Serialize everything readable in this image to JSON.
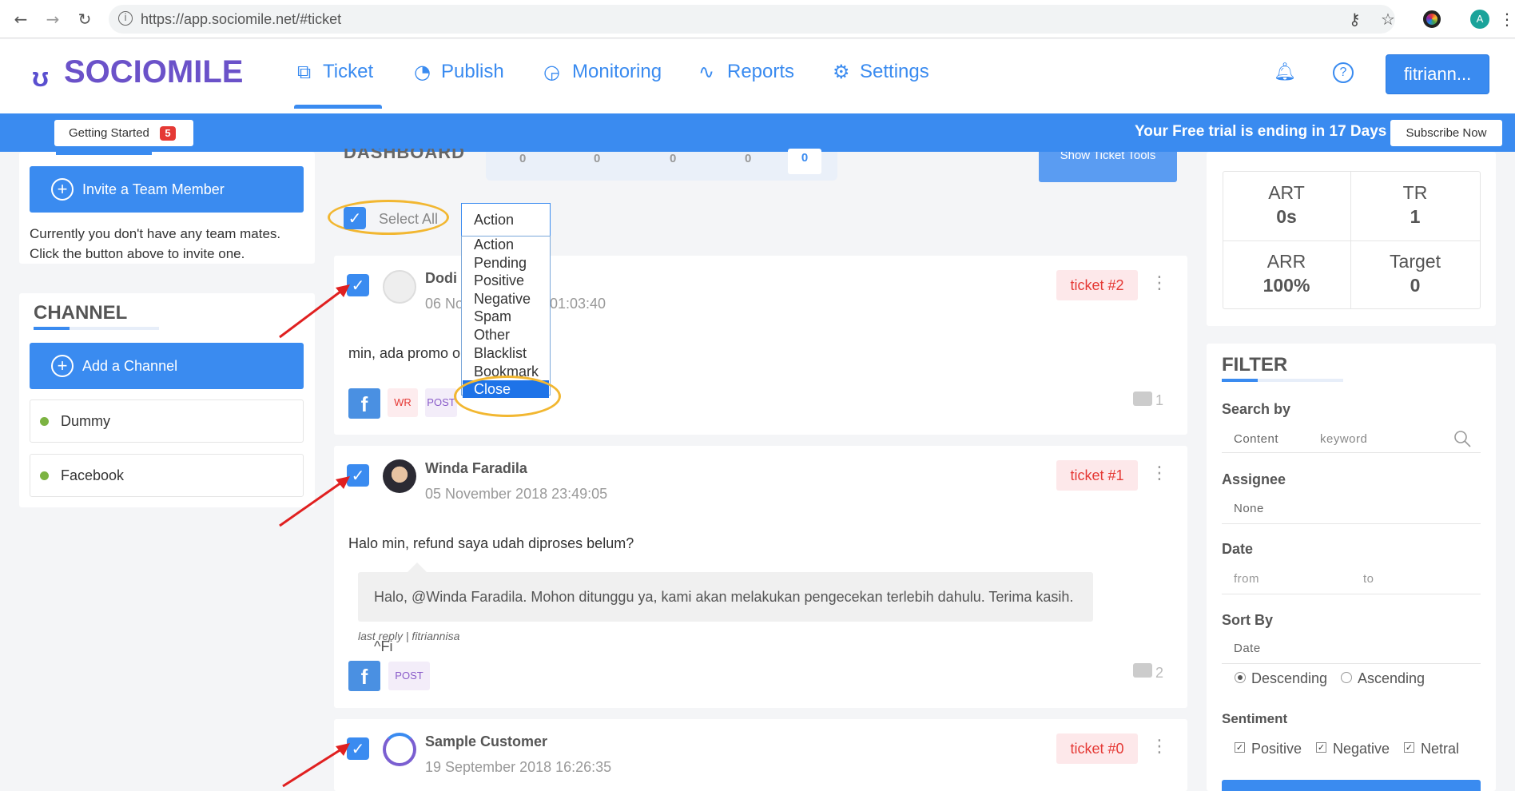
{
  "browser": {
    "url": "https://app.sociomile.net/#ticket",
    "profile_initial": "A"
  },
  "header": {
    "logo": "SOCIOMILE",
    "nav": [
      {
        "label": "Ticket",
        "icon": "ticket-icon",
        "active": true
      },
      {
        "label": "Publish",
        "icon": "clock-icon"
      },
      {
        "label": "Monitoring",
        "icon": "monitor-icon"
      },
      {
        "label": "Reports",
        "icon": "pulse-icon"
      },
      {
        "label": "Settings",
        "icon": "gear-icon"
      }
    ],
    "user": "fitriann..."
  },
  "trial_bar": {
    "getting_started": "Getting Started",
    "badge": "5",
    "message": "Your Free trial is ending in 17 Days",
    "subscribe": "Subscribe Now"
  },
  "team": {
    "invite_label": "Invite a Team Member",
    "note": "Currently you don't have any team mates. Click the button above to invite one."
  },
  "channel": {
    "title": "CHANNEL",
    "add_label": "Add a Channel",
    "items": [
      "Dummy",
      "Facebook"
    ]
  },
  "dashboard": {
    "label": "DASHBOARD",
    "stats": [
      "0",
      "0",
      "0",
      "0",
      "0"
    ],
    "tools_label": "Show Ticket Tools"
  },
  "bulk": {
    "select_all": "Select All",
    "action_value": "Action",
    "options": [
      "Action",
      "Pending",
      "Positive",
      "Negative",
      "Spam",
      "Other",
      "Blacklist",
      "Bookmark",
      "Close"
    ],
    "highlighted": "Close"
  },
  "tickets": [
    {
      "name": "Dodi",
      "date_start": "06 No",
      "date_end": "01:03:40",
      "message": "min, ada promo or",
      "badge": "ticket #2",
      "tags": [
        "WR",
        "POST"
      ],
      "replies": "1"
    },
    {
      "name": "Winda Faradila",
      "date": "05 November 2018 23:49:05",
      "message": "Halo min, refund saya udah diproses belum?",
      "reply": "Halo, @Winda Faradila. Mohon ditunggu ya, kami akan melakukan pengecekan terlebih dahulu. Terima kasih. ^Fi",
      "last_reply": "last reply | fitriannisa",
      "badge": "ticket #1",
      "tags": [
        "POST"
      ],
      "replies": "2"
    },
    {
      "name": "Sample Customer",
      "date": "19 September 2018 16:26:35",
      "badge": "ticket #0"
    }
  ],
  "kpi": [
    {
      "label": "ART",
      "value": "0s"
    },
    {
      "label": "TR",
      "value": "1"
    },
    {
      "label": "ARR",
      "value": "100%"
    },
    {
      "label": "Target",
      "value": "0"
    }
  ],
  "filter": {
    "title": "FILTER",
    "search_by_label": "Search by",
    "search_by_value": "Content",
    "keyword_placeholder": "keyword",
    "assignee_label": "Assignee",
    "assignee_value": "None",
    "date_label": "Date",
    "date_from": "from",
    "date_to": "to",
    "sort_label": "Sort By",
    "sort_value": "Date",
    "sort_desc": "Descending",
    "sort_asc": "Ascending",
    "sentiment_label": "Sentiment",
    "sentiments": [
      "Positive",
      "Negative",
      "Netral"
    ]
  },
  "colors": {
    "primary": "#3a8bf0",
    "logo": "#6b52c9",
    "badge_red": "#e53935",
    "highlight_ring": "#f2b731",
    "annotation_arrow": "#e02020"
  }
}
